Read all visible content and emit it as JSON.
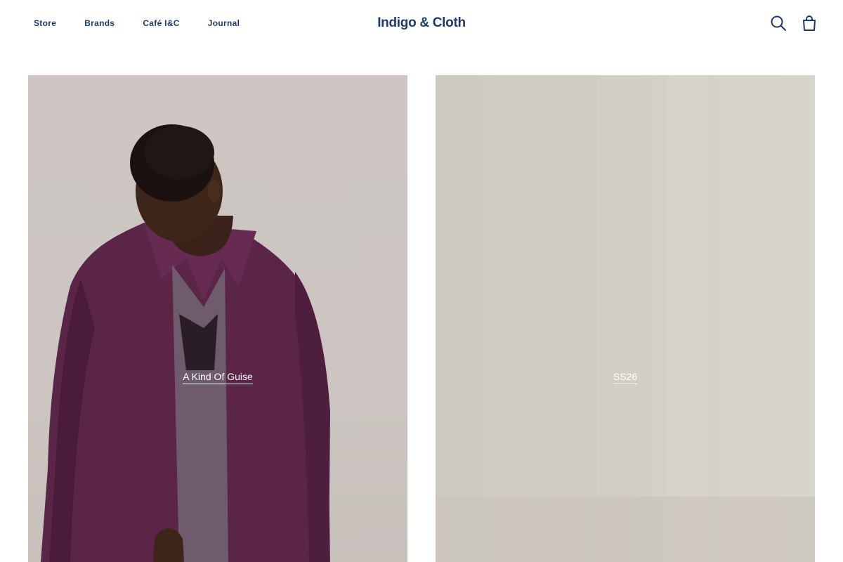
{
  "header": {
    "nav": [
      {
        "label": "Store"
      },
      {
        "label": "Brands"
      },
      {
        "label": "Café I&C"
      },
      {
        "label": "Journal"
      }
    ],
    "logo": "Indigo & Cloth",
    "icons": [
      "search-icon",
      "bag-icon"
    ]
  },
  "colors": {
    "brand": "#1f3a6e",
    "background": "#ffffff",
    "tile_label": "#ffffff"
  },
  "tiles": [
    {
      "label": "A Kind Of Guise"
    },
    {
      "label": "SS26"
    }
  ]
}
